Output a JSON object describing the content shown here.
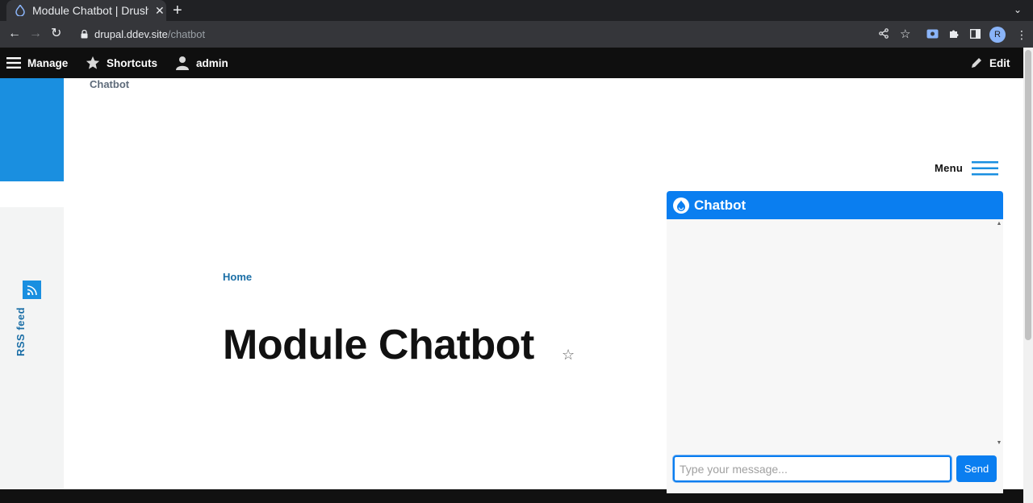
{
  "browser": {
    "tab_title": "Module Chatbot | Drush S",
    "url_host": "drupal.ddev.site",
    "url_path": "/chatbot",
    "profile_initial": "R"
  },
  "admin_toolbar": {
    "manage": "Manage",
    "shortcuts": "Shortcuts",
    "user": "admin",
    "edit": "Edit"
  },
  "site": {
    "name": "Chatbot",
    "menu_label": "Menu",
    "rss_label": "RSS feed"
  },
  "breadcrumb": {
    "home": "Home"
  },
  "page": {
    "title": "Module Chatbot"
  },
  "chatbot": {
    "title": "Chatbot",
    "input_placeholder": "Type your message...",
    "send_label": "Send"
  },
  "colors": {
    "accent": "#0a7ef0",
    "site_blue": "#1a8fe0",
    "admin_bar": "#0f0f0f"
  }
}
